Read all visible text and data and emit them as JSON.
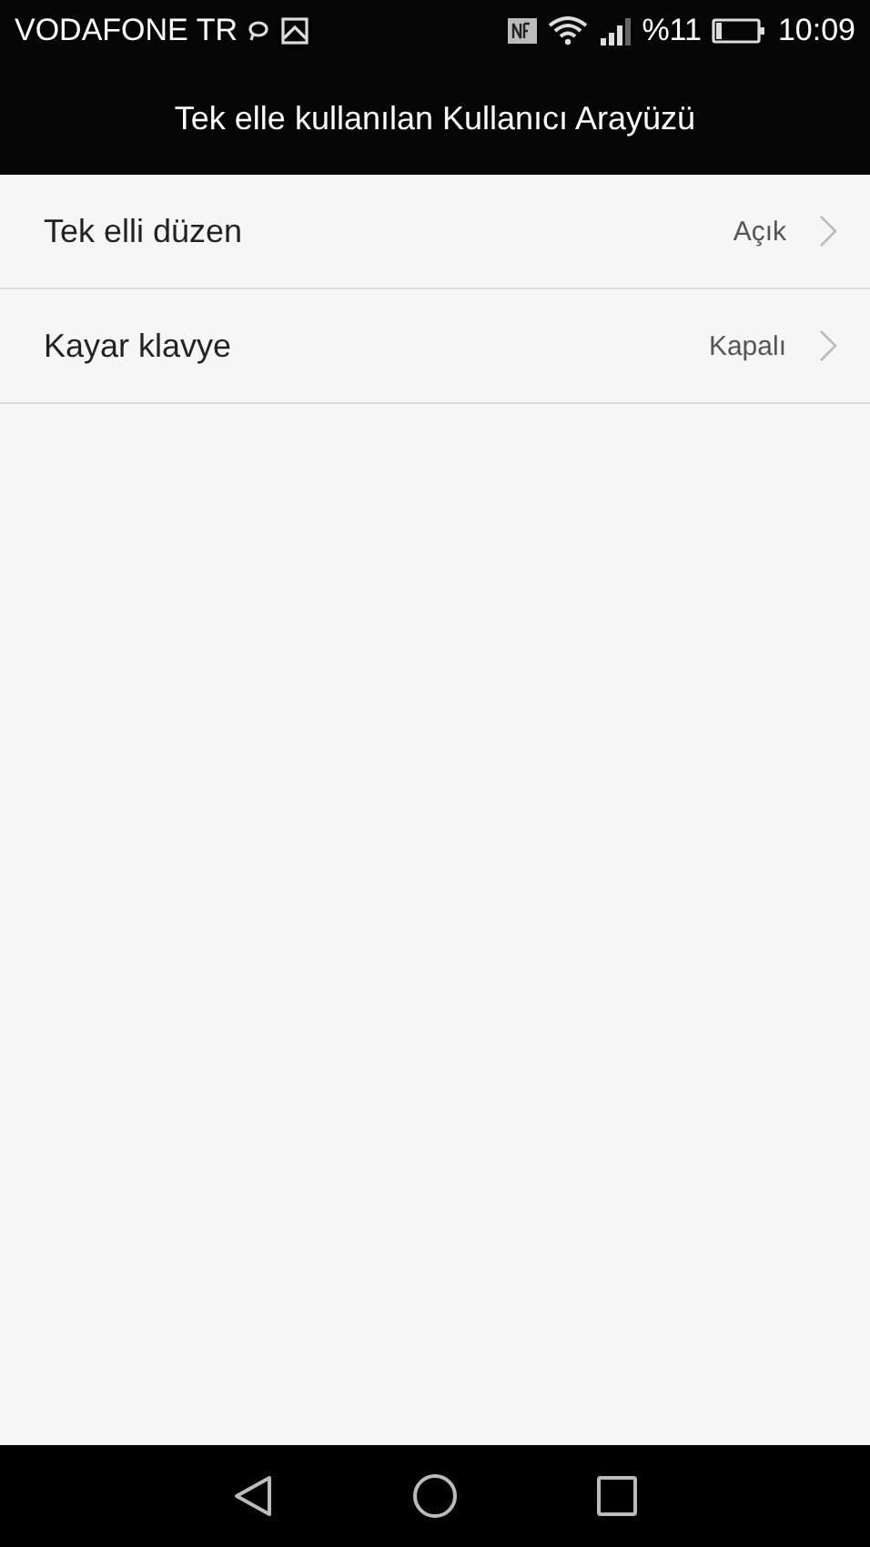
{
  "status_bar": {
    "carrier": "VODAFONE TR",
    "battery": "%11",
    "time": "10:09"
  },
  "header": {
    "title": "Tek elle kullanılan Kullanıcı Arayüzü"
  },
  "settings": [
    {
      "label": "Tek elli düzen",
      "value": "Açık"
    },
    {
      "label": "Kayar klavye",
      "value": "Kapalı"
    }
  ]
}
